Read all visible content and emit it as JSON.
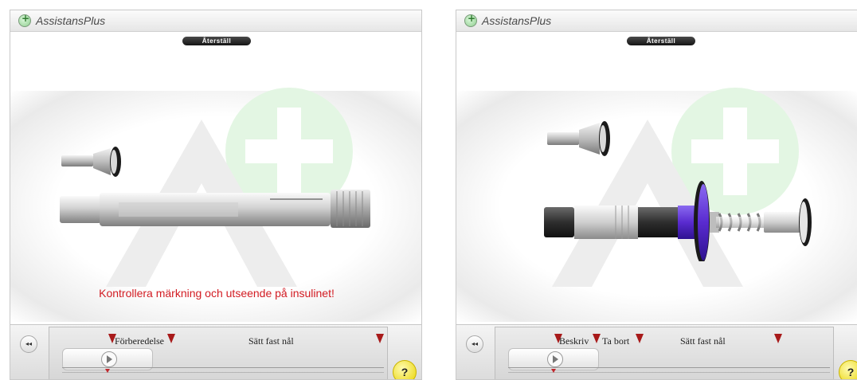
{
  "panels": [
    {
      "app_title": "AssistansPlus",
      "reset_label": "Återställ",
      "message": "Kontrollera märkning och utseende på insulinet!",
      "rewind_icon": "◂◂",
      "help_label": "?",
      "chapters": [
        "Förberedelse",
        "Sätt fast nål"
      ]
    },
    {
      "app_title": "AssistansPlus",
      "reset_label": "Återställ",
      "rewind_icon": "◂◂",
      "help_label": "?",
      "chapters": [
        "Beskriv",
        "Ta bort",
        "Sätt fast nål"
      ]
    }
  ],
  "colors": {
    "message_red": "#d21b22",
    "marker_red": "#a81a1a",
    "plunger_purple": "#5a2bd0",
    "watermark_green": "#dff5df",
    "help_yellow": "#e8d200"
  }
}
